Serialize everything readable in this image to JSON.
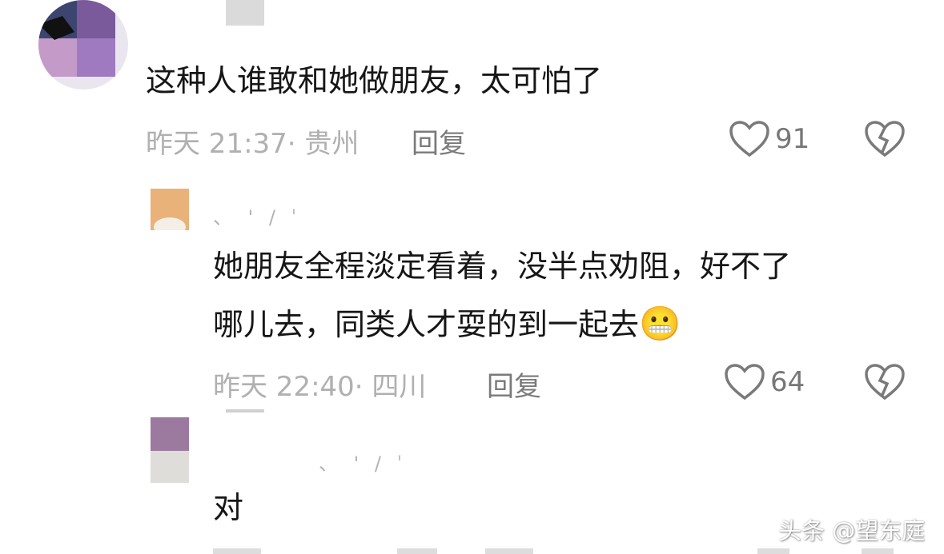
{
  "comments": [
    {
      "text": "这种人谁敢和她做朋友，太可怕了",
      "time": "昨天 21:37",
      "location": "· 贵州",
      "reply_label": "回复",
      "likes": "91",
      "avatar_colors": [
        "#3c4470",
        "#7a5a9a",
        "#c49ac8",
        "#a07ac0",
        "#e9e6ef"
      ]
    },
    {
      "text_line1": "她朋友全程淡定看着，没半点劝阻，好不了",
      "text_line2": "哪儿去，同类人才耍的到一起去",
      "emoji": "😬",
      "time": "昨天 22:40",
      "location": "· 四川",
      "reply_label": "回复",
      "likes": "64",
      "avatar_colors": [
        "#e9b278",
        "#f4efe6"
      ]
    },
    {
      "text": "对",
      "avatar_colors": [
        "#9c7aa0",
        "#deddd9"
      ]
    }
  ],
  "watermark": "头条 @望东庭",
  "colors": {
    "like_icon": "#7a7a7a",
    "dislike_icon": "#7a7a7a"
  },
  "icons": {
    "like": "heart-outline-icon",
    "dislike": "broken-heart-icon"
  }
}
